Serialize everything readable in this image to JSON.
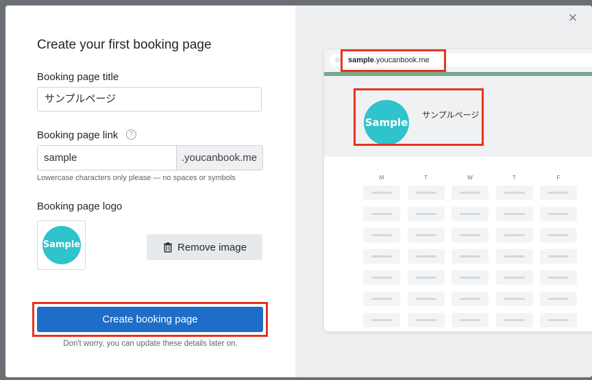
{
  "dialog": {
    "title": "Create your first booking page",
    "close_icon": "×"
  },
  "form": {
    "title_label": "Booking page title",
    "title_value": "サンプルページ",
    "link_label": "Booking page link",
    "help_icon": "?",
    "link_value": "sample",
    "link_suffix": ".youcanbook.me",
    "link_hint": "Lowercase characters only please — no spaces or symbols",
    "logo_label": "Booking page logo",
    "logo_text": "Sample",
    "remove_button": "Remove image",
    "submit_button": "Create booking page",
    "footnote": "Don't worry, you can update these details later on."
  },
  "preview": {
    "url_bold": "sample",
    "url_rest": ".youcanbook.me",
    "logo_text": "Sample",
    "page_name": "サンプルページ",
    "days": [
      "M",
      "T",
      "W",
      "T",
      "F"
    ],
    "slot_rows": 7
  },
  "colors": {
    "primary": "#1e6dc8",
    "highlight": "#e8321f",
    "logo": "#2fc3cc",
    "accent_line": "#7aa88e"
  }
}
